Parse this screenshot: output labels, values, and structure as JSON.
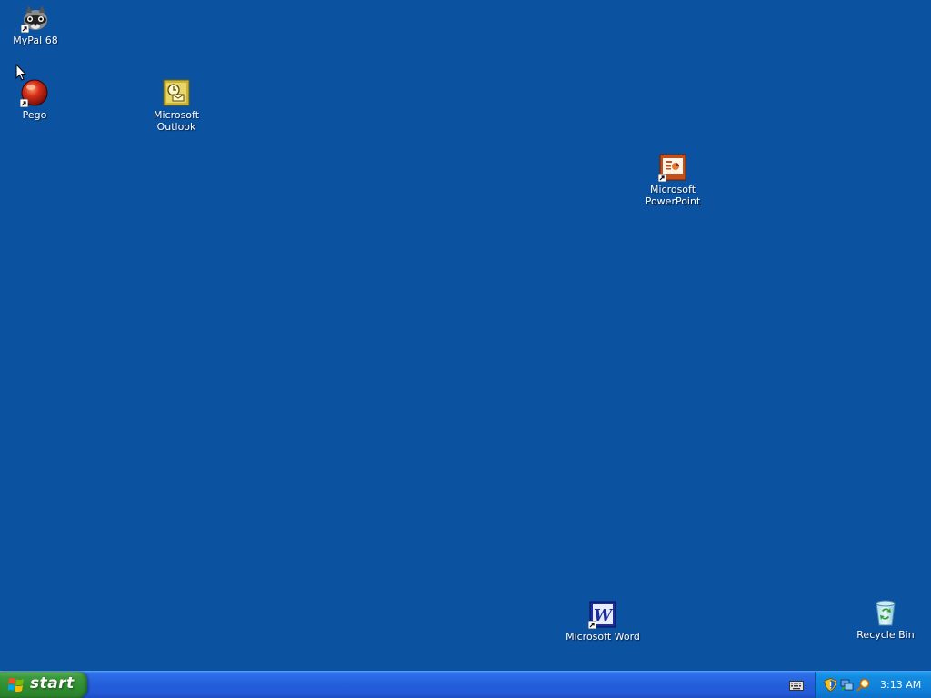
{
  "desktop": {
    "background_color": "#0b52a0",
    "icons": [
      {
        "label": "MyPal 68",
        "icon": "raccoon-icon",
        "shortcut": true
      },
      {
        "label": "Pego",
        "icon": "red-orb-icon",
        "shortcut": true
      },
      {
        "label": "Microsoft\nOutlook",
        "icon": "outlook-icon",
        "shortcut": false
      },
      {
        "label": "Microsoft\nPowerPoint",
        "icon": "powerpoint-icon",
        "shortcut": true
      },
      {
        "label": "Microsoft Word",
        "icon": "word-icon",
        "shortcut": true
      },
      {
        "label": "Recycle Bin",
        "icon": "recycle-bin-icon",
        "shortcut": false
      }
    ]
  },
  "taskbar": {
    "start_label": "start",
    "tray_icons": [
      "keyboard-icon",
      "security-shield-icon",
      "network-icon",
      "search-icon"
    ],
    "clock": "3:13 AM",
    "colors": {
      "taskbar": "#245edb",
      "start_button": "#3c9a3c",
      "tray": "#0f7fd9"
    }
  }
}
